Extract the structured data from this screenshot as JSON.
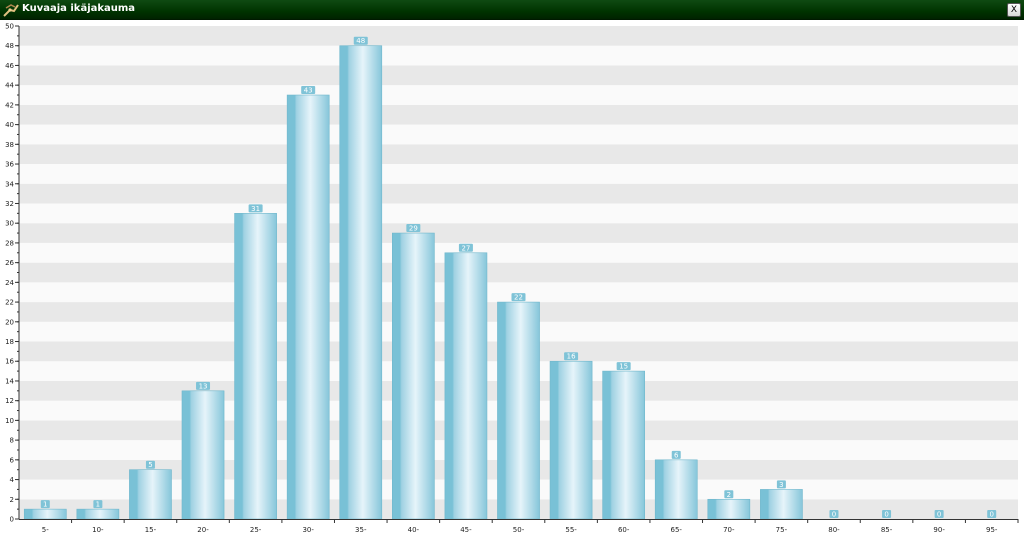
{
  "window": {
    "title": "Kuvaaja ikäjakauma",
    "close_label": "X"
  },
  "colors": {
    "title_bar": "#003300",
    "bar_light": "#e6f4fa",
    "bar_dark": "#79c1d6",
    "label_bg": "#7fc3d7",
    "stripe": "#e8e8e8"
  },
  "chart_data": {
    "type": "bar",
    "categories": [
      "5-",
      "10-",
      "15-",
      "20-",
      "25-",
      "30-",
      "35-",
      "40-",
      "45-",
      "50-",
      "55-",
      "60-",
      "65-",
      "70-",
      "75-",
      "80-",
      "85-",
      "90-",
      "95-"
    ],
    "values": [
      1,
      1,
      5,
      13,
      31,
      43,
      48,
      29,
      27,
      22,
      16,
      15,
      6,
      2,
      3,
      0,
      0,
      0,
      0
    ],
    "title": "",
    "xlabel": "",
    "ylabel": "",
    "ylim": [
      0,
      50
    ],
    "yticks": [
      0,
      2,
      4,
      6,
      8,
      10,
      12,
      14,
      16,
      18,
      20,
      22,
      24,
      26,
      28,
      30,
      32,
      34,
      36,
      38,
      40,
      42,
      44,
      46,
      48,
      50
    ],
    "grid": "horizontal bands",
    "data_labels": true
  }
}
